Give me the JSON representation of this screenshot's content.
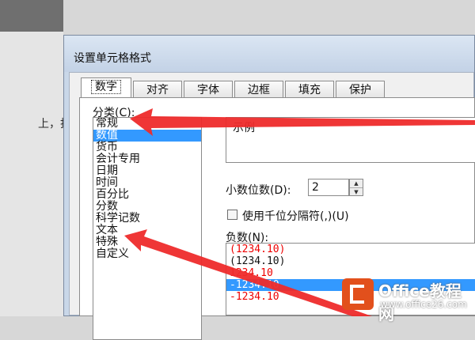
{
  "background": {
    "text": "上，找到出"
  },
  "dialog": {
    "title": "设置单元格格式",
    "tabs": [
      {
        "label": "数字",
        "active": true
      },
      {
        "label": "对齐",
        "active": false
      },
      {
        "label": "字体",
        "active": false
      },
      {
        "label": "边框",
        "active": false
      },
      {
        "label": "填充",
        "active": false
      },
      {
        "label": "保护",
        "active": false
      }
    ],
    "category": {
      "label": "分类(C):",
      "items": [
        "常规",
        "数值",
        "货币",
        "会计专用",
        "日期",
        "时间",
        "百分比",
        "分数",
        "科学记数",
        "文本",
        "特殊",
        "自定义"
      ],
      "selected_index": 1
    },
    "sample": {
      "label": "示例"
    },
    "decimal": {
      "label": "小数位数(D):",
      "value": "2"
    },
    "thousands": {
      "label": "使用千位分隔符(,)(U)",
      "checked": false
    },
    "negative": {
      "label": "负数(N):",
      "items": [
        {
          "text": "(1234.10)",
          "color": "red"
        },
        {
          "text": "(1234.10)",
          "color": "black"
        },
        {
          "text": "1234.10",
          "color": "red"
        },
        {
          "text": "-1234.10",
          "color": "black",
          "selected": true
        },
        {
          "text": "-1234.10",
          "color": "red"
        }
      ]
    }
  },
  "watermark": {
    "title": "Office教程网",
    "url": "www.office26.com"
  },
  "colors": {
    "selection": "#3399ff",
    "arrow": "#ee2b2b",
    "negative_red": "#e00000",
    "logo": "#e2501c"
  }
}
